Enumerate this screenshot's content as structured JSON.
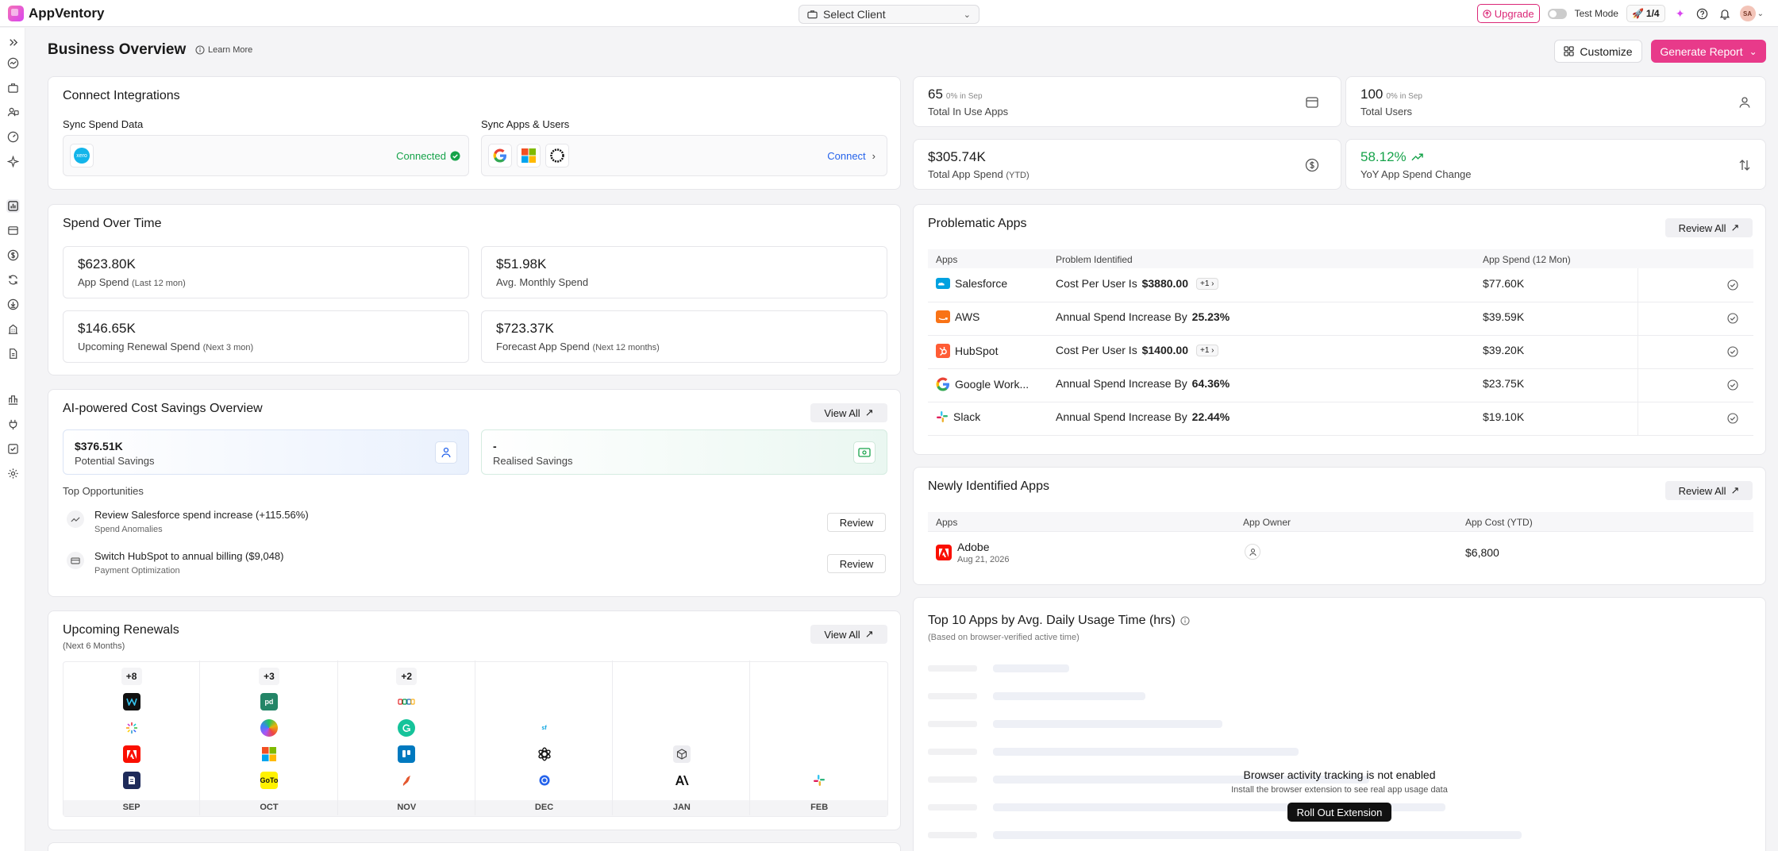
{
  "app": {
    "name": "AppVentory"
  },
  "topbar": {
    "client_placeholder": "Select Client",
    "upgrade_label": "Upgrade",
    "test_mode_label": "Test Mode",
    "progress_label": "1/4",
    "avatar_initials": "SA"
  },
  "header": {
    "title": "Business Overview",
    "learn_more": "Learn More",
    "customize_label": "Customize",
    "generate_label": "Generate Report"
  },
  "integrations": {
    "title": "Connect Integrations",
    "sync_spend_title": "Sync Spend Data",
    "sync_spend_status": "Connected",
    "sync_apps_title": "Sync Apps & Users",
    "sync_apps_action": "Connect",
    "spend_logo_text": "xero"
  },
  "stats": {
    "in_use": {
      "value": "65",
      "change": "0% in Sep",
      "label": "Total In Use Apps"
    },
    "users": {
      "value": "100",
      "change": "0% in Sep",
      "label": "Total Users"
    },
    "spend": {
      "value": "$305.74K",
      "label": "Total App Spend",
      "qualifier": "(YTD)"
    },
    "yoy": {
      "value": "58.12%",
      "label": "YoY App Spend Change",
      "color": "#16a34a"
    }
  },
  "spend_over_time": {
    "title": "Spend Over Time",
    "metrics": [
      {
        "value": "$623.80K",
        "label": "App Spend",
        "qualifier": "(Last 12 mon)"
      },
      {
        "value": "$51.98K",
        "label": "Avg. Monthly Spend",
        "qualifier": ""
      },
      {
        "value": "$146.65K",
        "label": "Upcoming Renewal Spend",
        "qualifier": "(Next 3 mon)"
      },
      {
        "value": "$723.37K",
        "label": "Forecast App Spend",
        "qualifier": "(Next 12 months)"
      }
    ]
  },
  "savings": {
    "title": "AI-powered Cost Savings Overview",
    "view_all": "View All",
    "potential_value": "$376.51K",
    "potential_label": "Potential Savings",
    "realised_value": "-",
    "realised_label": "Realised Savings",
    "opportunities_title": "Top Opportunities",
    "opportunities": [
      {
        "title": "Review Salesforce spend increase (+115.56%)",
        "category": "Spend Anomalies",
        "action": "Review",
        "icon": "trend-up-icon"
      },
      {
        "title": "Switch HubSpot to annual billing ($9,048)",
        "category": "Payment Optimization",
        "action": "Review",
        "icon": "card-icon"
      }
    ]
  },
  "renewals": {
    "title": "Upcoming Renewals",
    "subtitle": "(Next 6 Months)",
    "view_all": "View All",
    "months": [
      "SEP",
      "OCT",
      "NOV",
      "DEC",
      "JAN",
      "FEB"
    ],
    "extra_counts": [
      "+8",
      "+3",
      "+2"
    ],
    "icon_texts": {
      "pandadoc": "pd",
      "gofundme": "GoTo",
      "sf": "sf"
    }
  },
  "problematic": {
    "title": "Problematic Apps",
    "review_all": "Review All",
    "columns": [
      "Apps",
      "Problem Identified",
      "App Spend (12 Mon)"
    ],
    "rows": [
      {
        "app": "Salesforce",
        "problem_prefix": "Cost Per User Is ",
        "problem_value": "$3880.00",
        "more": "+1",
        "spend": "$77.60K",
        "color": "#0ea5e9"
      },
      {
        "app": "AWS",
        "problem_prefix": "Annual Spend Increase By ",
        "problem_value": "25.23%",
        "more": "",
        "spend": "$39.59K",
        "color": "#f97316"
      },
      {
        "app": "HubSpot",
        "problem_prefix": "Cost Per User Is ",
        "problem_value": "$1400.00",
        "more": "+1",
        "spend": "$39.20K",
        "color": "#f25c2a"
      },
      {
        "app": "Google Work...",
        "problem_prefix": "Annual Spend Increase By ",
        "problem_value": "64.36%",
        "more": "",
        "spend": "$23.75K",
        "color": "#4285f4"
      },
      {
        "app": "Slack",
        "problem_prefix": "Annual Spend Increase By ",
        "problem_value": "22.44%",
        "more": "",
        "spend": "$19.10K",
        "color": "#611f69"
      }
    ]
  },
  "newly_identified": {
    "title": "Newly Identified Apps",
    "review_all": "Review All",
    "columns": [
      "Apps",
      "App Owner",
      "App Cost (YTD)"
    ],
    "rows": [
      {
        "app": "Adobe",
        "date": "Aug 21, 2026",
        "cost": "$6,800"
      }
    ]
  },
  "usage": {
    "title": "Top 10 Apps by Avg. Daily Usage Time (hrs)",
    "subtitle": "(Based on browser-verified active time)",
    "empty_title": "Browser activity tracking is not enabled",
    "empty_subtitle": "Install the browser extension to see real app usage data",
    "action": "Roll Out Extension",
    "skeleton_fractions": [
      0.13,
      0.26,
      0.39,
      0.52,
      0.64,
      0.77,
      0.9
    ]
  }
}
